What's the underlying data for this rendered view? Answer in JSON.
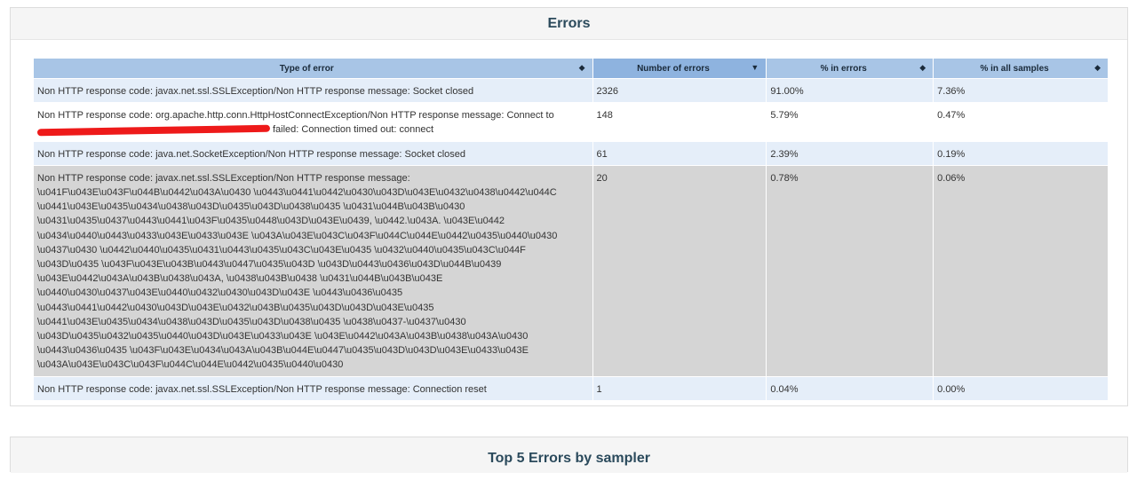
{
  "errors_panel": {
    "title": "Errors"
  },
  "table": {
    "headers": {
      "type": "Type of error",
      "number": "Number of errors",
      "pct_errors": "% in errors",
      "pct_samples": "% in all samples"
    },
    "rows": [
      {
        "type": "Non HTTP response code: javax.net.ssl.SSLException/Non HTTP response message: Socket closed",
        "number": "2326",
        "pct_errors": "91.00%",
        "pct_samples": "7.36%"
      },
      {
        "type_start": "Non HTTP response code: org.apache.http.conn.HttpHostConnectException/Non HTTP response message: Connect to",
        "type_end": "failed: Connection timed out: connect",
        "number": "148",
        "pct_errors": "5.79%",
        "pct_samples": "0.47%"
      },
      {
        "type": "Non HTTP response code: java.net.SocketException/Non HTTP response message: Socket closed",
        "number": "61",
        "pct_errors": "2.39%",
        "pct_samples": "0.19%"
      },
      {
        "type": "Non HTTP response code: javax.net.ssl.SSLException/Non HTTP response message: \\u041F\\u043E\\u043F\\u044B\\u0442\\u043A\\u0430 \\u0443\\u0441\\u0442\\u0430\\u043D\\u043E\\u0432\\u0438\\u0442\\u044C \\u0441\\u043E\\u0435\\u0434\\u0438\\u043D\\u0435\\u043D\\u0438\\u0435 \\u0431\\u044B\\u043B\\u0430 \\u0431\\u0435\\u0437\\u0443\\u0441\\u043F\\u0435\\u0448\\u043D\\u043E\\u0439, \\u0442.\\u043A. \\u043E\\u0442 \\u0434\\u0440\\u0443\\u0433\\u043E\\u0433\\u043E \\u043A\\u043E\\u043C\\u043F\\u044C\\u044E\\u0442\\u0435\\u0440\\u0430 \\u0437\\u0430 \\u0442\\u0440\\u0435\\u0431\\u0443\\u0435\\u043C\\u043E\\u0435 \\u0432\\u0440\\u0435\\u043C\\u044F \\u043D\\u0435 \\u043F\\u043E\\u043B\\u0443\\u0447\\u0435\\u043D \\u043D\\u0443\\u0436\\u043D\\u044B\\u0439 \\u043E\\u0442\\u043A\\u043B\\u0438\\u043A, \\u0438\\u043B\\u0438 \\u0431\\u044B\\u043B\\u043E \\u0440\\u0430\\u0437\\u043E\\u0440\\u0432\\u0430\\u043D\\u043E \\u0443\\u0436\\u0435 \\u0443\\u0441\\u0442\\u0430\\u043D\\u043E\\u0432\\u043B\\u0435\\u043D\\u043D\\u043E\\u0435 \\u0441\\u043E\\u0435\\u0434\\u0438\\u043D\\u0435\\u043D\\u0438\\u0435 \\u0438\\u0437-\\u0437\\u0430 \\u043D\\u0435\\u0432\\u0435\\u0440\\u043D\\u043E\\u0433\\u043E \\u043E\\u0442\\u043A\\u043B\\u0438\\u043A\\u0430 \\u0443\\u0436\\u0435 \\u043F\\u043E\\u0434\\u043A\\u043B\\u044E\\u0447\\u0435\\u043D\\u043D\\u043E\\u0433\\u043E \\u043A\\u043E\\u043C\\u043F\\u044C\\u044E\\u0442\\u0435\\u0440\\u0430",
        "number": "20",
        "pct_errors": "0.78%",
        "pct_samples": "0.06%"
      },
      {
        "type": "Non HTTP response code: javax.net.ssl.SSLException/Non HTTP response message: Connection reset",
        "number": "1",
        "pct_errors": "0.04%",
        "pct_samples": "0.00%"
      }
    ]
  },
  "top5_panel": {
    "title": "Top 5 Errors by sampler"
  },
  "icons": {
    "sort_both": "sort-both-icon",
    "sort_desc": "sort-desc-icon"
  },
  "colors": {
    "header_bg": "#a8c5e6",
    "header_sorted_bg": "#8eb3df",
    "row_odd_bg": "#e5eef9",
    "row_grey_bg": "#d5d5d5",
    "redaction": "#ee1a1a",
    "title_color": "#2b4a5c"
  }
}
